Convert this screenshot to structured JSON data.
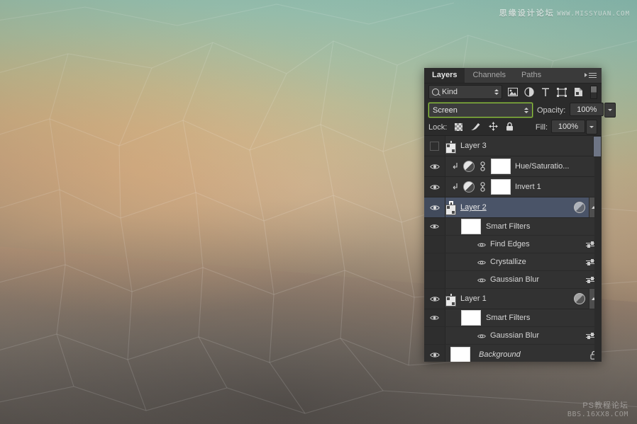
{
  "watermarks": {
    "top_cn": "思缘设计论坛",
    "top_en": "WWW.MISSYUAN.COM",
    "bottom_cn": "PS教程论坛",
    "bottom_en": "BBS.16XX8.COM"
  },
  "panel": {
    "tabs": [
      {
        "label": "Layers",
        "active": true
      },
      {
        "label": "Channels",
        "active": false
      },
      {
        "label": "Paths",
        "active": false
      }
    ],
    "menu_icon": "panel-menu-icon",
    "filter": {
      "kind_label": "Kind",
      "search_icon": "search-icon",
      "icons": [
        "pixel-layer-filter-icon",
        "adjustment-layer-filter-icon",
        "type-layer-filter-icon",
        "shape-layer-filter-icon",
        "smart-object-filter-icon"
      ],
      "toggle_icon": "filter-enable-toggle"
    },
    "blend": {
      "mode": "Screen",
      "opacity_label": "Opacity:",
      "opacity_value": "100%",
      "fill_label": "Fill:",
      "fill_value": "100%"
    },
    "lock": {
      "label": "Lock:",
      "icons": [
        "lock-transparent-pixels-icon",
        "lock-image-pixels-icon",
        "lock-position-icon",
        "lock-all-icon"
      ]
    },
    "layers": [
      {
        "kind": "layer",
        "name": "Layer 3",
        "visible": false,
        "selected": false,
        "thumb": "photo",
        "smart_object": true,
        "clipped": false,
        "adjustment": false,
        "mask": false,
        "fx": false,
        "locked": false,
        "expander": false
      },
      {
        "kind": "adjustment",
        "name": "Hue/Saturatio...",
        "visible": true,
        "selected": false,
        "thumb": "white",
        "smart_object": false,
        "clipped": true,
        "adjustment": true,
        "mask": true,
        "fx": false,
        "locked": false,
        "expander": false
      },
      {
        "kind": "adjustment",
        "name": "Invert 1",
        "visible": true,
        "selected": false,
        "thumb": "white",
        "smart_object": false,
        "clipped": true,
        "adjustment": true,
        "mask": true,
        "fx": false,
        "locked": false,
        "expander": false
      },
      {
        "kind": "smart",
        "name": "Layer 2",
        "visible": true,
        "selected": true,
        "editing": true,
        "thumb": "white",
        "smart_object": true,
        "clipped": false,
        "adjustment": false,
        "mask": false,
        "fx": true,
        "locked": false,
        "expander": true,
        "smart_filters": {
          "header": "Smart Filters",
          "header_visible": true,
          "items": [
            {
              "name": "Find Edges",
              "visible": true
            },
            {
              "name": "Crystallize",
              "visible": true
            },
            {
              "name": "Gaussian Blur",
              "visible": true
            }
          ]
        }
      },
      {
        "kind": "smart",
        "name": "Layer 1",
        "visible": true,
        "selected": false,
        "thumb": "photo2",
        "smart_object": true,
        "clipped": false,
        "adjustment": false,
        "mask": false,
        "fx": true,
        "locked": false,
        "expander": true,
        "smart_filters": {
          "header": "Smart Filters",
          "header_visible": true,
          "items": [
            {
              "name": "Gaussian Blur",
              "visible": true
            }
          ]
        }
      },
      {
        "kind": "background",
        "name": "Background",
        "visible": true,
        "selected": false,
        "italic": true,
        "thumb": "white",
        "smart_object": false,
        "clipped": false,
        "adjustment": false,
        "mask": false,
        "fx": false,
        "locked": true,
        "expander": false
      }
    ]
  },
  "colors": {
    "panel_bg": "#2b2b2b",
    "list_bg": "#323232",
    "selection": "#4a5468",
    "blend_highlight": "#8fc63d",
    "text": "#d8d8d8"
  }
}
